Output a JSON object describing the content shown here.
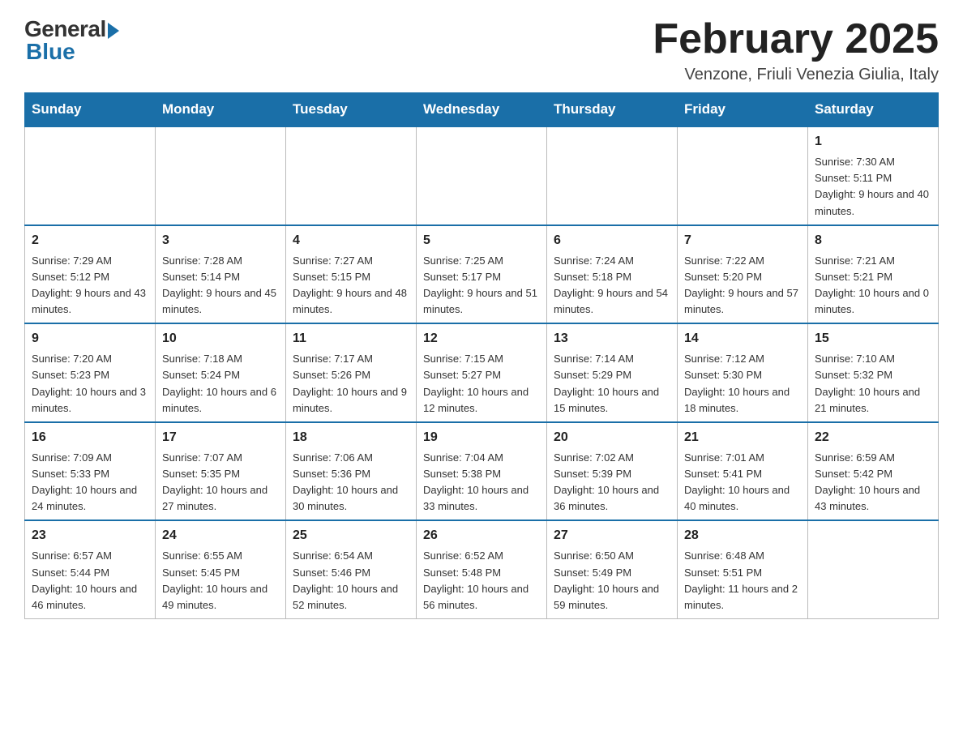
{
  "logo": {
    "general": "General",
    "blue": "Blue"
  },
  "title": "February 2025",
  "location": "Venzone, Friuli Venezia Giulia, Italy",
  "days_of_week": [
    "Sunday",
    "Monday",
    "Tuesday",
    "Wednesday",
    "Thursday",
    "Friday",
    "Saturday"
  ],
  "weeks": [
    [
      {
        "day": "",
        "info": ""
      },
      {
        "day": "",
        "info": ""
      },
      {
        "day": "",
        "info": ""
      },
      {
        "day": "",
        "info": ""
      },
      {
        "day": "",
        "info": ""
      },
      {
        "day": "",
        "info": ""
      },
      {
        "day": "1",
        "info": "Sunrise: 7:30 AM\nSunset: 5:11 PM\nDaylight: 9 hours and 40 minutes."
      }
    ],
    [
      {
        "day": "2",
        "info": "Sunrise: 7:29 AM\nSunset: 5:12 PM\nDaylight: 9 hours and 43 minutes."
      },
      {
        "day": "3",
        "info": "Sunrise: 7:28 AM\nSunset: 5:14 PM\nDaylight: 9 hours and 45 minutes."
      },
      {
        "day": "4",
        "info": "Sunrise: 7:27 AM\nSunset: 5:15 PM\nDaylight: 9 hours and 48 minutes."
      },
      {
        "day": "5",
        "info": "Sunrise: 7:25 AM\nSunset: 5:17 PM\nDaylight: 9 hours and 51 minutes."
      },
      {
        "day": "6",
        "info": "Sunrise: 7:24 AM\nSunset: 5:18 PM\nDaylight: 9 hours and 54 minutes."
      },
      {
        "day": "7",
        "info": "Sunrise: 7:22 AM\nSunset: 5:20 PM\nDaylight: 9 hours and 57 minutes."
      },
      {
        "day": "8",
        "info": "Sunrise: 7:21 AM\nSunset: 5:21 PM\nDaylight: 10 hours and 0 minutes."
      }
    ],
    [
      {
        "day": "9",
        "info": "Sunrise: 7:20 AM\nSunset: 5:23 PM\nDaylight: 10 hours and 3 minutes."
      },
      {
        "day": "10",
        "info": "Sunrise: 7:18 AM\nSunset: 5:24 PM\nDaylight: 10 hours and 6 minutes."
      },
      {
        "day": "11",
        "info": "Sunrise: 7:17 AM\nSunset: 5:26 PM\nDaylight: 10 hours and 9 minutes."
      },
      {
        "day": "12",
        "info": "Sunrise: 7:15 AM\nSunset: 5:27 PM\nDaylight: 10 hours and 12 minutes."
      },
      {
        "day": "13",
        "info": "Sunrise: 7:14 AM\nSunset: 5:29 PM\nDaylight: 10 hours and 15 minutes."
      },
      {
        "day": "14",
        "info": "Sunrise: 7:12 AM\nSunset: 5:30 PM\nDaylight: 10 hours and 18 minutes."
      },
      {
        "day": "15",
        "info": "Sunrise: 7:10 AM\nSunset: 5:32 PM\nDaylight: 10 hours and 21 minutes."
      }
    ],
    [
      {
        "day": "16",
        "info": "Sunrise: 7:09 AM\nSunset: 5:33 PM\nDaylight: 10 hours and 24 minutes."
      },
      {
        "day": "17",
        "info": "Sunrise: 7:07 AM\nSunset: 5:35 PM\nDaylight: 10 hours and 27 minutes."
      },
      {
        "day": "18",
        "info": "Sunrise: 7:06 AM\nSunset: 5:36 PM\nDaylight: 10 hours and 30 minutes."
      },
      {
        "day": "19",
        "info": "Sunrise: 7:04 AM\nSunset: 5:38 PM\nDaylight: 10 hours and 33 minutes."
      },
      {
        "day": "20",
        "info": "Sunrise: 7:02 AM\nSunset: 5:39 PM\nDaylight: 10 hours and 36 minutes."
      },
      {
        "day": "21",
        "info": "Sunrise: 7:01 AM\nSunset: 5:41 PM\nDaylight: 10 hours and 40 minutes."
      },
      {
        "day": "22",
        "info": "Sunrise: 6:59 AM\nSunset: 5:42 PM\nDaylight: 10 hours and 43 minutes."
      }
    ],
    [
      {
        "day": "23",
        "info": "Sunrise: 6:57 AM\nSunset: 5:44 PM\nDaylight: 10 hours and 46 minutes."
      },
      {
        "day": "24",
        "info": "Sunrise: 6:55 AM\nSunset: 5:45 PM\nDaylight: 10 hours and 49 minutes."
      },
      {
        "day": "25",
        "info": "Sunrise: 6:54 AM\nSunset: 5:46 PM\nDaylight: 10 hours and 52 minutes."
      },
      {
        "day": "26",
        "info": "Sunrise: 6:52 AM\nSunset: 5:48 PM\nDaylight: 10 hours and 56 minutes."
      },
      {
        "day": "27",
        "info": "Sunrise: 6:50 AM\nSunset: 5:49 PM\nDaylight: 10 hours and 59 minutes."
      },
      {
        "day": "28",
        "info": "Sunrise: 6:48 AM\nSunset: 5:51 PM\nDaylight: 11 hours and 2 minutes."
      },
      {
        "day": "",
        "info": ""
      }
    ]
  ]
}
